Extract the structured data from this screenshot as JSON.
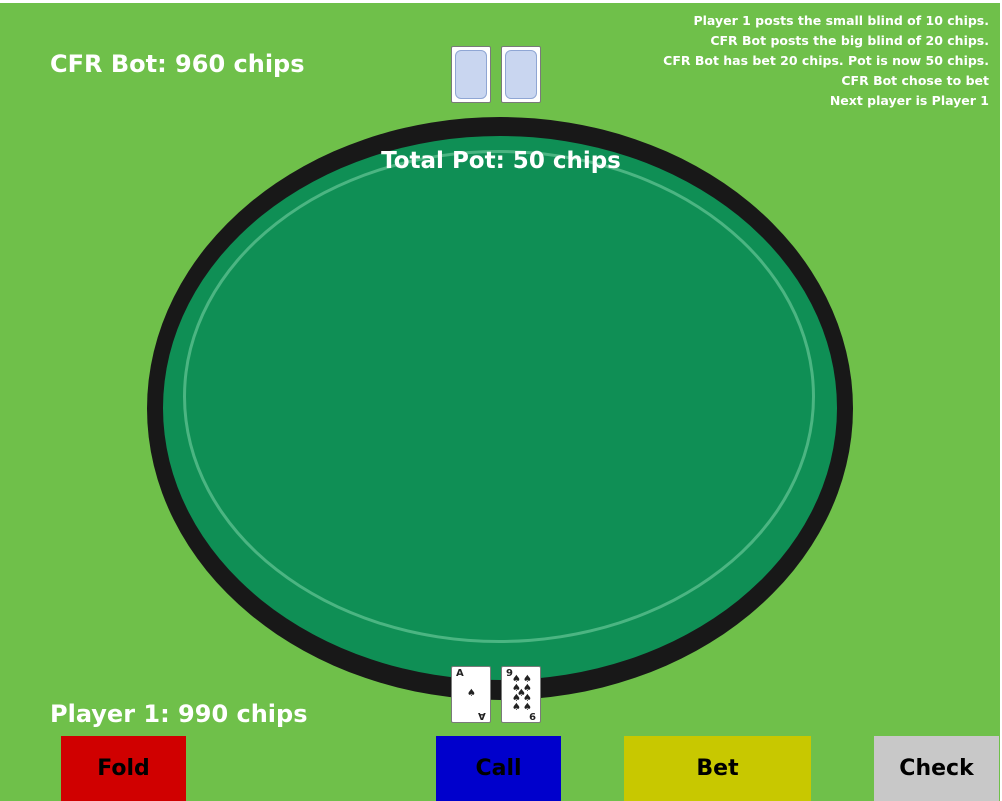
{
  "players": {
    "bot_label": "CFR Bot: 960 chips",
    "human_label": "Player 1: 990 chips"
  },
  "log": [
    "Player 1 posts the small blind of 10 chips.",
    "CFR Bot posts the big blind of 20 chips.",
    "CFR Bot has bet 20 chips. Pot is now 50 chips.",
    "CFR Bot chose to bet",
    "Next player is Player 1"
  ],
  "pot": "Total Pot: 50 chips",
  "cards": {
    "human": [
      {
        "rank": "A",
        "suit": "♠"
      },
      {
        "rank": "9",
        "suit": "♠"
      }
    ]
  },
  "buttons": {
    "fold": "Fold",
    "call": "Call",
    "bet": "Bet",
    "check": "Check"
  },
  "colors": {
    "background": "#6fc04a",
    "felt": "#0f8f55",
    "rail": "#181818",
    "fold": "#d00000",
    "call": "#0000cc",
    "bet": "#c8c800",
    "check": "#c8c8c8"
  }
}
